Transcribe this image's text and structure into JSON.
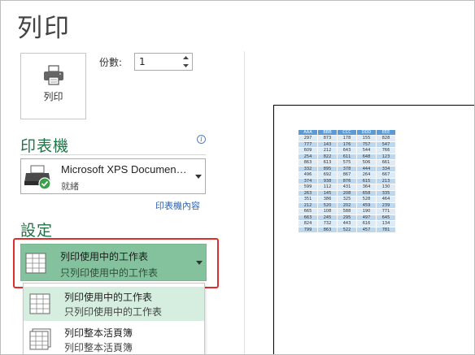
{
  "title": "列印",
  "print_button": {
    "label": "列印",
    "icon": "printer-icon"
  },
  "copies": {
    "label": "份數:",
    "value": "1"
  },
  "printer": {
    "heading": "印表機",
    "name": "Microsoft XPS Documen…",
    "status": "就緒",
    "properties_link": "印表機內容",
    "info_icon": "info-icon"
  },
  "settings": {
    "heading": "設定",
    "selected": {
      "title": "列印使用中的工作表",
      "subtitle": "只列印使用中的工作表"
    },
    "options": [
      {
        "title": "列印使用中的工作表",
        "subtitle": "只列印使用中的工作表"
      },
      {
        "title": "列印整本活頁簿",
        "subtitle": "列印整本活頁簿"
      }
    ]
  },
  "preview": {
    "headers": [
      "AAA",
      "BBB",
      "CCC",
      "DDD",
      "EEE"
    ],
    "rows": [
      [
        "297",
        "873",
        "178",
        "155",
        "828"
      ],
      [
        "777",
        "143",
        "176",
        "757",
        "547"
      ],
      [
        "609",
        "212",
        "643",
        "544",
        "766"
      ],
      [
        "254",
        "822",
        "611",
        "648",
        "123"
      ],
      [
        "863",
        "613",
        "575",
        "506",
        "661"
      ],
      [
        "332",
        "895",
        "378",
        "444",
        "334"
      ],
      [
        "496",
        "692",
        "867",
        "264",
        "667"
      ],
      [
        "374",
        "938",
        "876",
        "615",
        "213"
      ],
      [
        "599",
        "112",
        "431",
        "364",
        "130"
      ],
      [
        "263",
        "145",
        "208",
        "658",
        "335"
      ],
      [
        "351",
        "386",
        "325",
        "528",
        "464"
      ],
      [
        "212",
        "520",
        "202",
        "459",
        "239"
      ],
      [
        "665",
        "108",
        "588",
        "190",
        "771"
      ],
      [
        "663",
        "245",
        "295",
        "497",
        "645"
      ],
      [
        "824",
        "732",
        "443",
        "616",
        "134"
      ],
      [
        "799",
        "863",
        "522",
        "457",
        "781"
      ]
    ]
  },
  "colors": {
    "accent_green": "#217346",
    "selection_green": "#84c29d",
    "highlight_red": "#e02d2d",
    "table_header": "#5b9bd5"
  }
}
